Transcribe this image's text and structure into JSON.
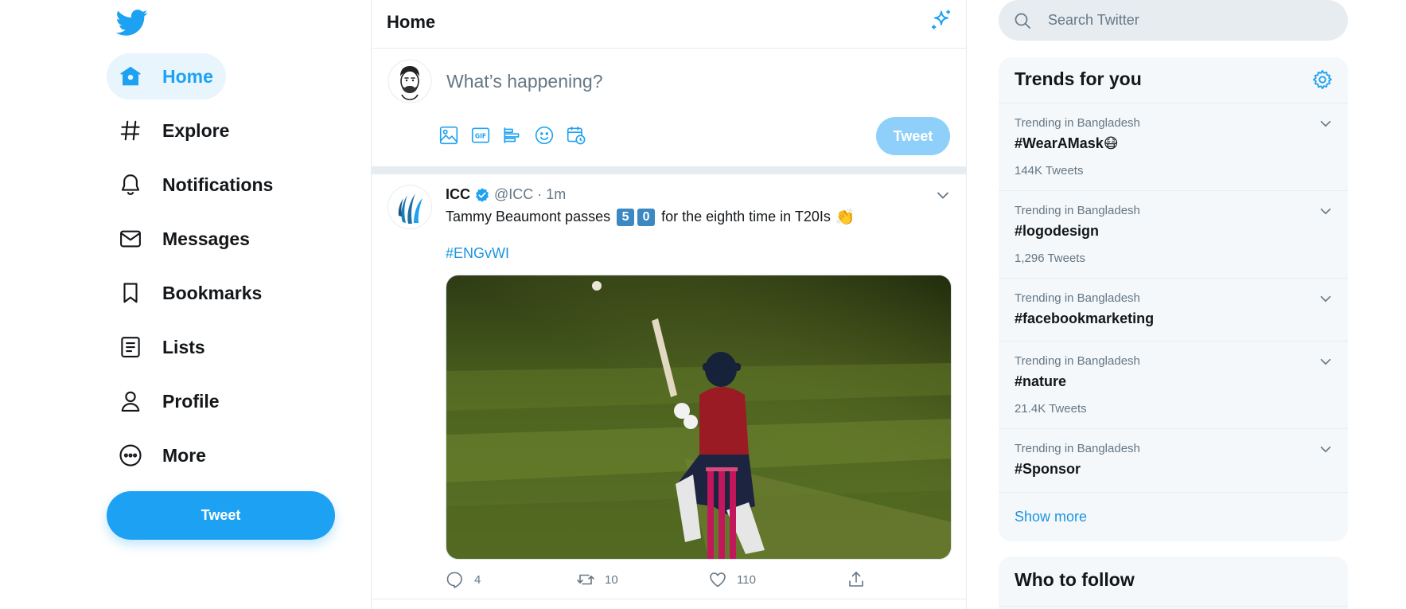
{
  "brand": {
    "accent": "#1da1f2",
    "logo_icon": "twitter-bird-icon"
  },
  "nav": {
    "items": [
      {
        "label": "Home",
        "icon": "home-icon"
      },
      {
        "label": "Explore",
        "icon": "hashtag-icon"
      },
      {
        "label": "Notifications",
        "icon": "bell-icon"
      },
      {
        "label": "Messages",
        "icon": "envelope-icon"
      },
      {
        "label": "Bookmarks",
        "icon": "bookmark-icon"
      },
      {
        "label": "Lists",
        "icon": "list-icon"
      },
      {
        "label": "Profile",
        "icon": "person-icon"
      },
      {
        "label": "More",
        "icon": "more-circle-icon"
      }
    ],
    "tweet_button": "Tweet"
  },
  "header": {
    "title": "Home"
  },
  "compose": {
    "placeholder": "What’s happening?",
    "tweet_button": "Tweet"
  },
  "tweet": {
    "name": "ICC",
    "handle": "@ICC",
    "separator": "·",
    "time": "1m",
    "text_before": "Tammy Beaumont passes",
    "keycap_1": "5",
    "keycap_2": "0",
    "text_after": "for the eighth time in T20Is",
    "emoji": "👏",
    "hashtag": "#ENGvWI",
    "replies": "4",
    "retweets": "10",
    "likes": "110"
  },
  "search": {
    "placeholder": "Search Twitter"
  },
  "trends": {
    "title": "Trends for you",
    "items": [
      {
        "context": "Trending in Bangladesh",
        "name": "#WearAMask",
        "emoji": "😷",
        "count": "144K Tweets"
      },
      {
        "context": "Trending in Bangladesh",
        "name": "#logodesign",
        "count": "1,296 Tweets"
      },
      {
        "context": "Trending in Bangladesh",
        "name": "#facebookmarketing"
      },
      {
        "context": "Trending in Bangladesh",
        "name": "#nature",
        "count": "21.4K Tweets"
      },
      {
        "context": "Trending in Bangladesh",
        "name": "#Sponsor"
      }
    ],
    "show_more": "Show more"
  },
  "who_to_follow": {
    "title": "Who to follow"
  }
}
